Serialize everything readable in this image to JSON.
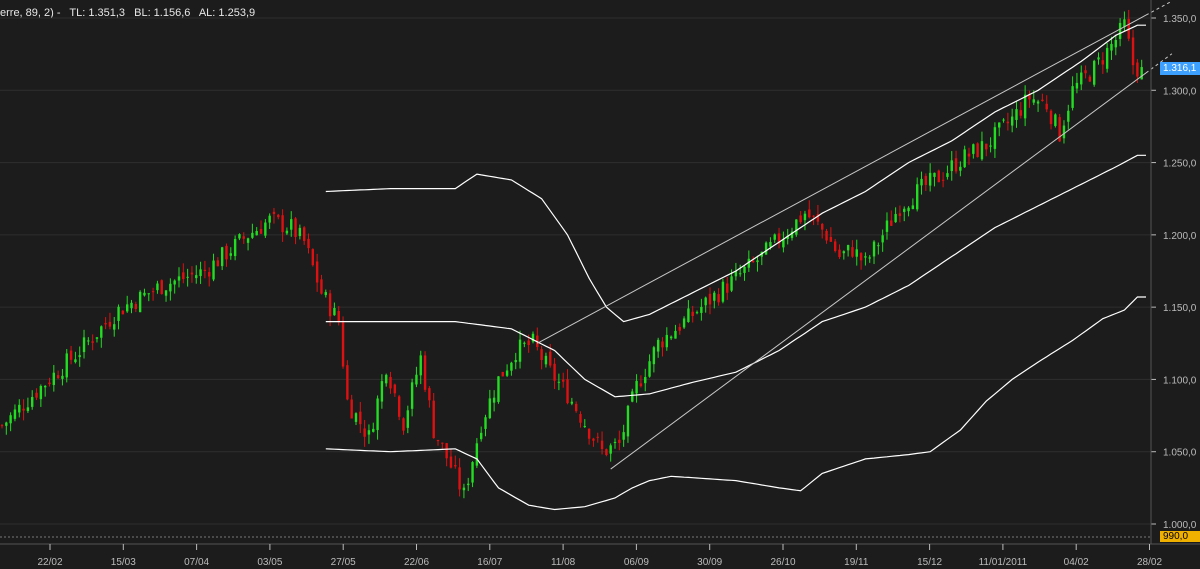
{
  "header": {
    "indicator": "erre, 89, 2) -",
    "tl": "TL: 1.351,3",
    "bl": "BL: 1.156,6",
    "al": "AL: 1.253,9"
  },
  "badges": {
    "last_price": "1.316,1",
    "min_level": "990,0"
  },
  "colors": {
    "background": "#1c1c1c",
    "up_candle": "#22dd22",
    "down_candle": "#dd1111",
    "bands": "#ffffff",
    "trendlines": "#c8c8c8",
    "axis_text": "#bbbbbb",
    "grid": "#2e2e2e",
    "price_badge": "#3da0ff",
    "min_badge": "#f0b000"
  },
  "chart_data": {
    "type": "candlestick",
    "x_labels": [
      "22/02",
      "15/03",
      "07/04",
      "03/05",
      "27/05",
      "22/06",
      "16/07",
      "11/08",
      "06/09",
      "30/09",
      "26/10",
      "19/11",
      "15/12",
      "11/01/2011",
      "04/02",
      "28/02"
    ],
    "y_ticks": [
      "1.000,0",
      "1.050,0",
      "1.100,0",
      "1.150,0",
      "1.200,0",
      "1.250,0",
      "1.300,0",
      "1.350,0"
    ],
    "ylim": [
      1000,
      1350
    ],
    "trading_days": 265,
    "close_path": [
      [
        0,
        1068
      ],
      [
        8,
        1092
      ],
      [
        18,
        1120
      ],
      [
        27,
        1148
      ],
      [
        37,
        1165
      ],
      [
        47,
        1175
      ],
      [
        57,
        1200
      ],
      [
        62,
        1210
      ],
      [
        67,
        1205
      ],
      [
        70,
        1195
      ],
      [
        74,
        1160
      ],
      [
        78,
        1140
      ],
      [
        80,
        1085
      ],
      [
        85,
        1060
      ],
      [
        89,
        1110
      ],
      [
        93,
        1070
      ],
      [
        97,
        1115
      ],
      [
        100,
        1065
      ],
      [
        104,
        1040
      ],
      [
        107,
        1020
      ],
      [
        111,
        1070
      ],
      [
        115,
        1100
      ],
      [
        119,
        1120
      ],
      [
        123,
        1125
      ],
      [
        127,
        1105
      ],
      [
        131,
        1090
      ],
      [
        135,
        1070
      ],
      [
        139,
        1050
      ],
      [
        143,
        1055
      ],
      [
        147,
        1095
      ],
      [
        152,
        1125
      ],
      [
        158,
        1140
      ],
      [
        164,
        1155
      ],
      [
        170,
        1170
      ],
      [
        176,
        1185
      ],
      [
        181,
        1200
      ],
      [
        186,
        1215
      ],
      [
        188,
        1210
      ],
      [
        191,
        1200
      ],
      [
        194,
        1185
      ],
      [
        197,
        1190
      ],
      [
        200,
        1180
      ],
      [
        203,
        1195
      ],
      [
        208,
        1220
      ],
      [
        213,
        1232
      ],
      [
        217,
        1240
      ],
      [
        222,
        1252
      ],
      [
        228,
        1262
      ],
      [
        234,
        1280
      ],
      [
        238,
        1295
      ],
      [
        242,
        1290
      ],
      [
        245,
        1270
      ],
      [
        248,
        1300
      ],
      [
        253,
        1315
      ],
      [
        258,
        1335
      ],
      [
        260,
        1345
      ],
      [
        262,
        1318
      ],
      [
        265,
        1310
      ]
    ],
    "bands": [
      {
        "name": "upper",
        "start": 75,
        "end": 265,
        "values": [
          [
            75,
            1230
          ],
          [
            90,
            1232
          ],
          [
            105,
            1232
          ],
          [
            110,
            1242
          ],
          [
            118,
            1238
          ],
          [
            125,
            1225
          ],
          [
            131,
            1200
          ],
          [
            136,
            1170
          ],
          [
            140,
            1150
          ],
          [
            144,
            1140
          ],
          [
            150,
            1145
          ],
          [
            160,
            1160
          ],
          [
            170,
            1175
          ],
          [
            180,
            1195
          ],
          [
            190,
            1215
          ],
          [
            200,
            1230
          ],
          [
            210,
            1250
          ],
          [
            220,
            1265
          ],
          [
            230,
            1285
          ],
          [
            240,
            1300
          ],
          [
            250,
            1320
          ],
          [
            258,
            1338
          ],
          [
            263,
            1345
          ]
        ]
      },
      {
        "name": "middle",
        "start": 75,
        "end": 265,
        "values": [
          [
            75,
            1140
          ],
          [
            90,
            1140
          ],
          [
            105,
            1140
          ],
          [
            118,
            1135
          ],
          [
            128,
            1120
          ],
          [
            135,
            1100
          ],
          [
            142,
            1088
          ],
          [
            150,
            1090
          ],
          [
            160,
            1098
          ],
          [
            170,
            1105
          ],
          [
            180,
            1120
          ],
          [
            190,
            1140
          ],
          [
            200,
            1150
          ],
          [
            210,
            1165
          ],
          [
            220,
            1185
          ],
          [
            230,
            1205
          ],
          [
            240,
            1220
          ],
          [
            250,
            1235
          ],
          [
            258,
            1247
          ],
          [
            263,
            1255
          ]
        ]
      },
      {
        "name": "lower",
        "start": 75,
        "end": 265,
        "values": [
          [
            75,
            1052
          ],
          [
            90,
            1050
          ],
          [
            105,
            1052
          ],
          [
            110,
            1045
          ],
          [
            115,
            1025
          ],
          [
            122,
            1013
          ],
          [
            128,
            1010
          ],
          [
            135,
            1012
          ],
          [
            142,
            1018
          ],
          [
            146,
            1025
          ],
          [
            150,
            1030
          ],
          [
            155,
            1033
          ],
          [
            160,
            1032
          ],
          [
            170,
            1030
          ],
          [
            180,
            1025
          ],
          [
            185,
            1023
          ],
          [
            190,
            1035
          ],
          [
            200,
            1045
          ],
          [
            210,
            1048
          ],
          [
            215,
            1050
          ],
          [
            222,
            1065
          ],
          [
            228,
            1085
          ],
          [
            234,
            1100
          ],
          [
            240,
            1112
          ],
          [
            248,
            1127
          ],
          [
            255,
            1142
          ],
          [
            260,
            1148
          ],
          [
            263,
            1157
          ]
        ]
      }
    ],
    "trendlines": [
      {
        "name": "upper",
        "from": [
          124,
          1125
        ],
        "to": [
          265,
          1352
        ]
      },
      {
        "name": "lower",
        "from": [
          141,
          1038
        ],
        "to": [
          265,
          1312
        ]
      }
    ]
  }
}
